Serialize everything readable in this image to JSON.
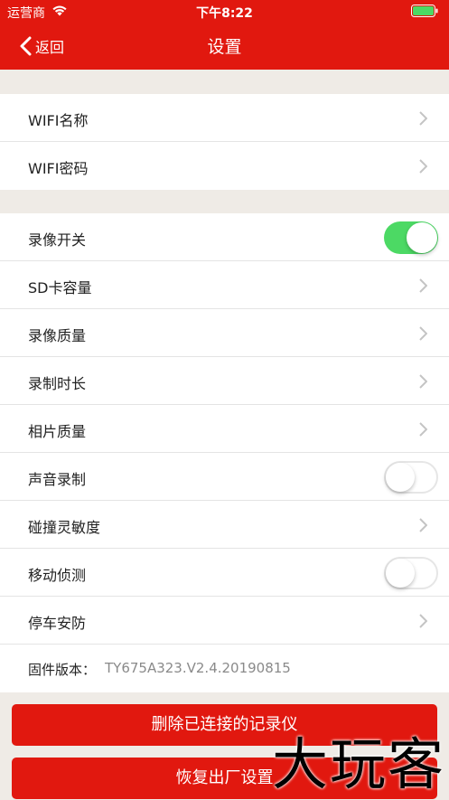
{
  "status_bar": {
    "carrier": "运营商",
    "time": "下午8:22",
    "battery_color": "#4cd964"
  },
  "nav": {
    "back_label": "返回",
    "title": "设置"
  },
  "groups": [
    {
      "rows": [
        {
          "label": "WIFI名称",
          "accessory": "chevron"
        },
        {
          "label": "WIFI密码",
          "accessory": "chevron"
        }
      ]
    },
    {
      "rows": [
        {
          "label": "录像开关",
          "accessory": "toggle",
          "on": true
        },
        {
          "label": "SD卡容量",
          "accessory": "chevron"
        },
        {
          "label": "录像质量",
          "accessory": "chevron"
        },
        {
          "label": "录制时长",
          "accessory": "chevron"
        },
        {
          "label": "相片质量",
          "accessory": "chevron"
        },
        {
          "label": "声音录制",
          "accessory": "toggle",
          "on": false
        },
        {
          "label": "碰撞灵敏度",
          "accessory": "chevron"
        },
        {
          "label": "移动侦测",
          "accessory": "toggle",
          "on": false
        },
        {
          "label": "停车安防",
          "accessory": "chevron"
        }
      ]
    }
  ],
  "firmware": {
    "label": "固件版本：",
    "value": "TY675A323.V2.4.20190815"
  },
  "buttons": {
    "delete_label": "删除已连接的记录仪",
    "reset_label": "恢复出厂设置"
  },
  "watermark": "大玩客",
  "colors": {
    "accent": "#e1180f",
    "toggle_on": "#4cd964",
    "background": "#efebe6"
  }
}
